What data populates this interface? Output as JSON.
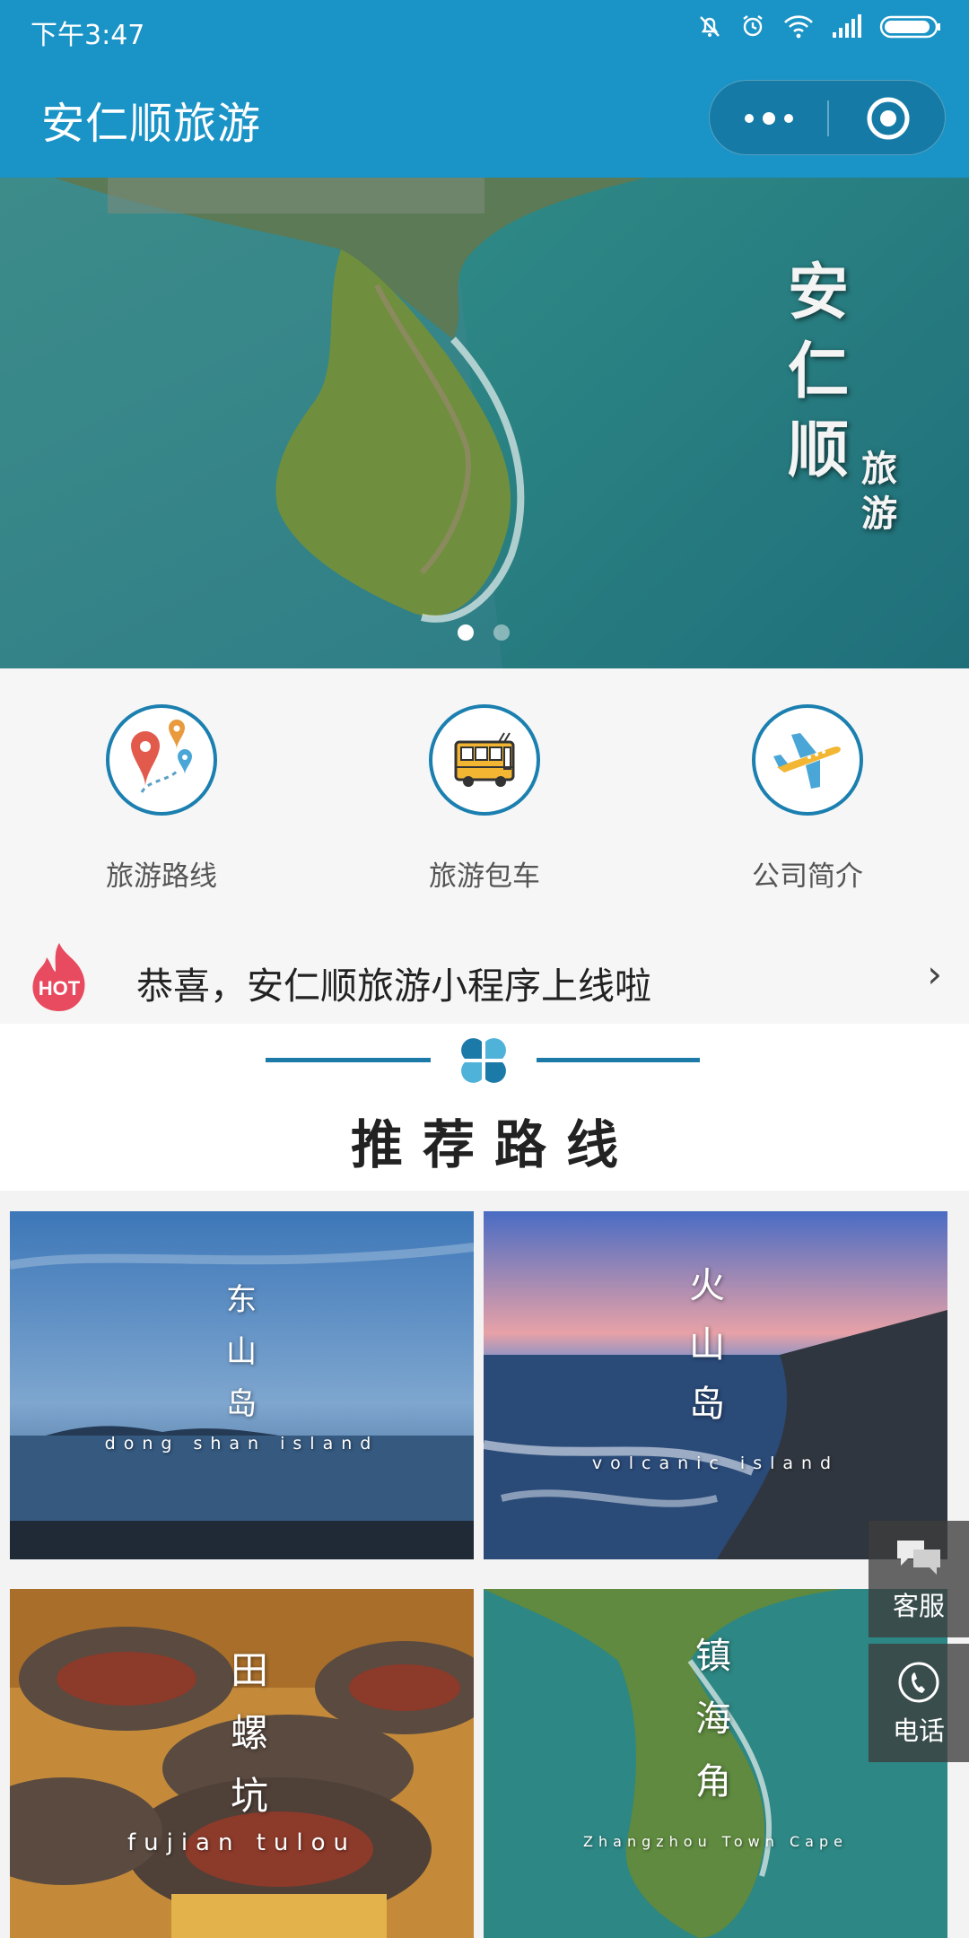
{
  "status": {
    "time": "下午3:47"
  },
  "header": {
    "title": "安仁顺旅游"
  },
  "banner": {
    "title_main": "安仁顺",
    "title_sub": "旅游",
    "slide_count": 2,
    "active_slide": 1
  },
  "nav": {
    "items": [
      {
        "label": "旅游路线",
        "icon": "map-pin-icon"
      },
      {
        "label": "旅游包车",
        "icon": "bus-icon"
      },
      {
        "label": "公司简介",
        "icon": "airplane-icon"
      }
    ]
  },
  "notice": {
    "badge": "HOT",
    "text": "恭喜，安仁顺旅游小程序上线啦",
    "arrow": "›"
  },
  "recommend": {
    "title": "推荐路线"
  },
  "routes": [
    {
      "cn": "东山岛",
      "en": "dong  shan  island"
    },
    {
      "cn": "火山岛",
      "en": "volcanic island"
    },
    {
      "cn": "田螺坑",
      "en": "fujian tulou"
    },
    {
      "cn": "镇海角",
      "en": "Zhangzhou Town Cape"
    }
  ],
  "float": {
    "service": "客服",
    "phone": "电话"
  },
  "colors": {
    "primary": "#1a93c6",
    "accent": "#1b7fb0",
    "hot": "#e84a5f"
  }
}
